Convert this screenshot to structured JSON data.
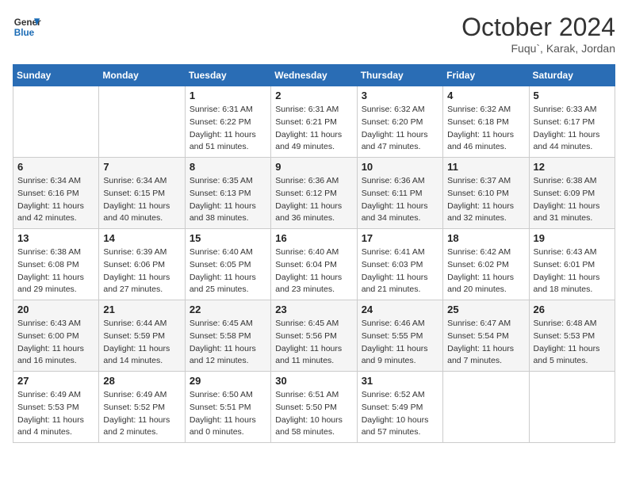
{
  "header": {
    "logo_line1": "General",
    "logo_line2": "Blue",
    "month": "October 2024",
    "location": "Fuqu`, Karak, Jordan"
  },
  "weekdays": [
    "Sunday",
    "Monday",
    "Tuesday",
    "Wednesday",
    "Thursday",
    "Friday",
    "Saturday"
  ],
  "weeks": [
    [
      {
        "day": "",
        "sunrise": "",
        "sunset": "",
        "daylight": ""
      },
      {
        "day": "",
        "sunrise": "",
        "sunset": "",
        "daylight": ""
      },
      {
        "day": "1",
        "sunrise": "Sunrise: 6:31 AM",
        "sunset": "Sunset: 6:22 PM",
        "daylight": "Daylight: 11 hours and 51 minutes."
      },
      {
        "day": "2",
        "sunrise": "Sunrise: 6:31 AM",
        "sunset": "Sunset: 6:21 PM",
        "daylight": "Daylight: 11 hours and 49 minutes."
      },
      {
        "day": "3",
        "sunrise": "Sunrise: 6:32 AM",
        "sunset": "Sunset: 6:20 PM",
        "daylight": "Daylight: 11 hours and 47 minutes."
      },
      {
        "day": "4",
        "sunrise": "Sunrise: 6:32 AM",
        "sunset": "Sunset: 6:18 PM",
        "daylight": "Daylight: 11 hours and 46 minutes."
      },
      {
        "day": "5",
        "sunrise": "Sunrise: 6:33 AM",
        "sunset": "Sunset: 6:17 PM",
        "daylight": "Daylight: 11 hours and 44 minutes."
      }
    ],
    [
      {
        "day": "6",
        "sunrise": "Sunrise: 6:34 AM",
        "sunset": "Sunset: 6:16 PM",
        "daylight": "Daylight: 11 hours and 42 minutes."
      },
      {
        "day": "7",
        "sunrise": "Sunrise: 6:34 AM",
        "sunset": "Sunset: 6:15 PM",
        "daylight": "Daylight: 11 hours and 40 minutes."
      },
      {
        "day": "8",
        "sunrise": "Sunrise: 6:35 AM",
        "sunset": "Sunset: 6:13 PM",
        "daylight": "Daylight: 11 hours and 38 minutes."
      },
      {
        "day": "9",
        "sunrise": "Sunrise: 6:36 AM",
        "sunset": "Sunset: 6:12 PM",
        "daylight": "Daylight: 11 hours and 36 minutes."
      },
      {
        "day": "10",
        "sunrise": "Sunrise: 6:36 AM",
        "sunset": "Sunset: 6:11 PM",
        "daylight": "Daylight: 11 hours and 34 minutes."
      },
      {
        "day": "11",
        "sunrise": "Sunrise: 6:37 AM",
        "sunset": "Sunset: 6:10 PM",
        "daylight": "Daylight: 11 hours and 32 minutes."
      },
      {
        "day": "12",
        "sunrise": "Sunrise: 6:38 AM",
        "sunset": "Sunset: 6:09 PM",
        "daylight": "Daylight: 11 hours and 31 minutes."
      }
    ],
    [
      {
        "day": "13",
        "sunrise": "Sunrise: 6:38 AM",
        "sunset": "Sunset: 6:08 PM",
        "daylight": "Daylight: 11 hours and 29 minutes."
      },
      {
        "day": "14",
        "sunrise": "Sunrise: 6:39 AM",
        "sunset": "Sunset: 6:06 PM",
        "daylight": "Daylight: 11 hours and 27 minutes."
      },
      {
        "day": "15",
        "sunrise": "Sunrise: 6:40 AM",
        "sunset": "Sunset: 6:05 PM",
        "daylight": "Daylight: 11 hours and 25 minutes."
      },
      {
        "day": "16",
        "sunrise": "Sunrise: 6:40 AM",
        "sunset": "Sunset: 6:04 PM",
        "daylight": "Daylight: 11 hours and 23 minutes."
      },
      {
        "day": "17",
        "sunrise": "Sunrise: 6:41 AM",
        "sunset": "Sunset: 6:03 PM",
        "daylight": "Daylight: 11 hours and 21 minutes."
      },
      {
        "day": "18",
        "sunrise": "Sunrise: 6:42 AM",
        "sunset": "Sunset: 6:02 PM",
        "daylight": "Daylight: 11 hours and 20 minutes."
      },
      {
        "day": "19",
        "sunrise": "Sunrise: 6:43 AM",
        "sunset": "Sunset: 6:01 PM",
        "daylight": "Daylight: 11 hours and 18 minutes."
      }
    ],
    [
      {
        "day": "20",
        "sunrise": "Sunrise: 6:43 AM",
        "sunset": "Sunset: 6:00 PM",
        "daylight": "Daylight: 11 hours and 16 minutes."
      },
      {
        "day": "21",
        "sunrise": "Sunrise: 6:44 AM",
        "sunset": "Sunset: 5:59 PM",
        "daylight": "Daylight: 11 hours and 14 minutes."
      },
      {
        "day": "22",
        "sunrise": "Sunrise: 6:45 AM",
        "sunset": "Sunset: 5:58 PM",
        "daylight": "Daylight: 11 hours and 12 minutes."
      },
      {
        "day": "23",
        "sunrise": "Sunrise: 6:45 AM",
        "sunset": "Sunset: 5:56 PM",
        "daylight": "Daylight: 11 hours and 11 minutes."
      },
      {
        "day": "24",
        "sunrise": "Sunrise: 6:46 AM",
        "sunset": "Sunset: 5:55 PM",
        "daylight": "Daylight: 11 hours and 9 minutes."
      },
      {
        "day": "25",
        "sunrise": "Sunrise: 6:47 AM",
        "sunset": "Sunset: 5:54 PM",
        "daylight": "Daylight: 11 hours and 7 minutes."
      },
      {
        "day": "26",
        "sunrise": "Sunrise: 6:48 AM",
        "sunset": "Sunset: 5:53 PM",
        "daylight": "Daylight: 11 hours and 5 minutes."
      }
    ],
    [
      {
        "day": "27",
        "sunrise": "Sunrise: 6:49 AM",
        "sunset": "Sunset: 5:53 PM",
        "daylight": "Daylight: 11 hours and 4 minutes."
      },
      {
        "day": "28",
        "sunrise": "Sunrise: 6:49 AM",
        "sunset": "Sunset: 5:52 PM",
        "daylight": "Daylight: 11 hours and 2 minutes."
      },
      {
        "day": "29",
        "sunrise": "Sunrise: 6:50 AM",
        "sunset": "Sunset: 5:51 PM",
        "daylight": "Daylight: 11 hours and 0 minutes."
      },
      {
        "day": "30",
        "sunrise": "Sunrise: 6:51 AM",
        "sunset": "Sunset: 5:50 PM",
        "daylight": "Daylight: 10 hours and 58 minutes."
      },
      {
        "day": "31",
        "sunrise": "Sunrise: 6:52 AM",
        "sunset": "Sunset: 5:49 PM",
        "daylight": "Daylight: 10 hours and 57 minutes."
      },
      {
        "day": "",
        "sunrise": "",
        "sunset": "",
        "daylight": ""
      },
      {
        "day": "",
        "sunrise": "",
        "sunset": "",
        "daylight": ""
      }
    ]
  ]
}
